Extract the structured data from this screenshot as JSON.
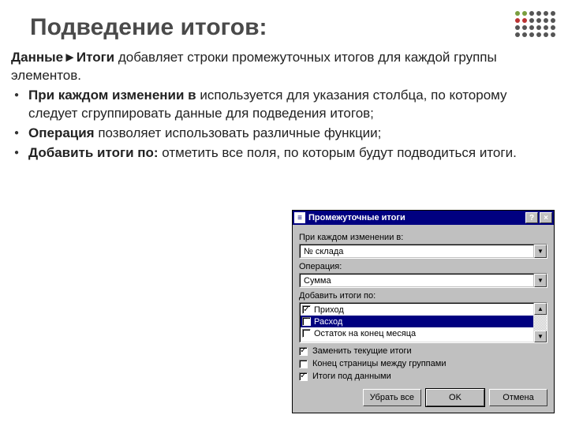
{
  "slide": {
    "title": "Подведение итогов:",
    "intro_bold": "Данные►Итоги",
    "intro_rest": " добавляет строки промежуточных итогов для каждой группы элементов.",
    "bullets": [
      {
        "bold": "При каждом изменении в",
        "rest": " используется для указания столбца, по которому следует сгруппировать данные для подведения итогов;"
      },
      {
        "bold": "Операция",
        "rest": " позволяет использовать различные функции;"
      },
      {
        "bold": "Добавить итоги по:",
        "rest": " отметить все поля, по которым будут подводиться итоги."
      }
    ]
  },
  "dialog": {
    "title": "Промежуточные итоги",
    "help_btn": "?",
    "close_btn": "×",
    "section1_label": "При каждом изменении в:",
    "combo1_value": "№ склада",
    "section2_label": "Операция:",
    "combo2_value": "Сумма",
    "section3_label": "Добавить итоги по:",
    "list": [
      {
        "checked": true,
        "selected": false,
        "label": "Приход"
      },
      {
        "checked": true,
        "selected": true,
        "label": "Расход"
      },
      {
        "checked": false,
        "selected": false,
        "label": "Остаток на конец месяца"
      }
    ],
    "opt1": {
      "checked": true,
      "label": "Заменить текущие итоги"
    },
    "opt2": {
      "checked": false,
      "label": "Конец страницы между группами"
    },
    "opt3": {
      "checked": true,
      "label": "Итоги под данными"
    },
    "btn_remove": "Убрать все",
    "btn_ok": "OK",
    "btn_cancel": "Отмена"
  },
  "decor_colors": [
    "#7a9e3e",
    "#7a9e3e",
    "#555",
    "#555",
    "#555",
    "#555",
    "#b33",
    "#b33",
    "#555",
    "#555",
    "#555",
    "#555",
    "#555",
    "#555",
    "#555",
    "#555",
    "#555",
    "#555",
    "#555",
    "#555",
    "#555",
    "#555",
    "#555",
    "#555"
  ]
}
